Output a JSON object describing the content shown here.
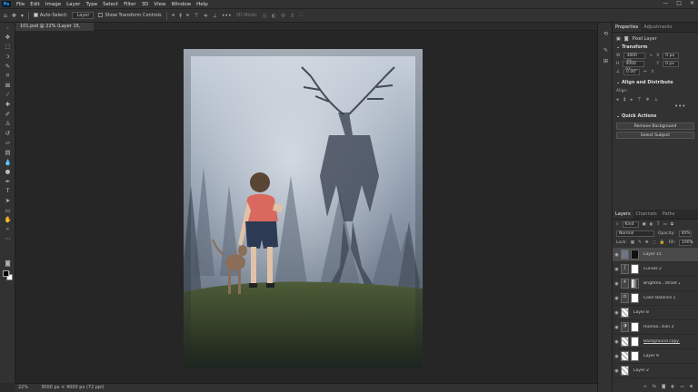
{
  "menubar": {
    "logo": "Ps",
    "items": [
      "File",
      "Edit",
      "Image",
      "Layer",
      "Type",
      "Select",
      "Filter",
      "3D",
      "View",
      "Window",
      "Help"
    ],
    "window_controls": [
      "—",
      "□",
      "✕"
    ]
  },
  "options": {
    "auto_select_label": "Auto-Select:",
    "auto_select_value": "Layer",
    "transform_label": "Show Transform Controls",
    "mode_3d": "3D Mode:"
  },
  "document": {
    "tab_label": "101.psd @ 22% (Layer 15, RGB/8#) *",
    "close": "×"
  },
  "statusbar": {
    "zoom": "22%",
    "size": "3000 px × 4000 px (72 ppi)"
  },
  "properties": {
    "tabs": [
      "Properties",
      "Adjustments"
    ],
    "layer_type": "Pixel Layer",
    "transform_title": "Transform",
    "w_label": "W",
    "w_value": "3000 px",
    "h_label": "H",
    "h_value": "4000 px",
    "x_label": "X",
    "x_value": "0 px",
    "y_label": "Y",
    "y_value": "0 px",
    "angle_value": "0.00°",
    "align_title": "Align and Distribute",
    "align_label": "Align:",
    "quick_title": "Quick Actions",
    "remove_bg": "Remove Background",
    "select_subject": "Select Subject",
    "more": "•••"
  },
  "layers_panel": {
    "tabs": [
      "Layers",
      "Channels",
      "Paths"
    ],
    "kind_label": "Kind",
    "blend_mode": "Normal",
    "opacity_label": "Opacity:",
    "opacity_value": "40%",
    "lock_label": "Lock:",
    "fill_label": "Fill:",
    "fill_value": "100%",
    "layers": [
      {
        "name": "Layer 15"
      },
      {
        "name": "Curves 2"
      },
      {
        "name": "Brightne...ntrast 2"
      },
      {
        "name": "Color Balance 1"
      },
      {
        "name": "Layer 8"
      },
      {
        "name": "Hue/Sa...tion 3"
      },
      {
        "name": "Background copy 2"
      },
      {
        "name": "Layer 9"
      },
      {
        "name": "Layer 2"
      }
    ]
  },
  "colors": {
    "accent": "#31a8ff",
    "ui_bg": "#323232",
    "workspace": "#262626"
  }
}
